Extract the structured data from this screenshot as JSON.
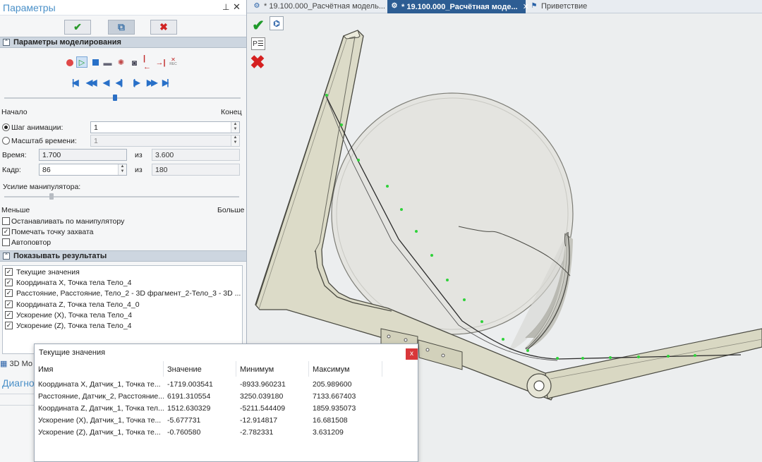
{
  "panel": {
    "title": "Параметры",
    "pin_icon": "pin-icon",
    "close_icon": "close-icon",
    "buttons": {
      "ok": "✔",
      "preview": "⧉",
      "cancel": "✖"
    }
  },
  "modeling": {
    "header": "Параметры моделирования",
    "toolbar_icons": [
      "record-icon",
      "play-icon",
      "stop-icon",
      "film-icon",
      "settings-icon",
      "camera-icon",
      "trim-start-icon",
      "trim-end-icon",
      "rec-icon"
    ],
    "timeline": {
      "start_label": "Начало",
      "end_label": "Конец",
      "position": 0.47
    },
    "anim_step": {
      "label": "Шаг анимации:",
      "value": "1",
      "selected": true
    },
    "time_scale": {
      "label": "Масштаб времени:",
      "value": "1",
      "selected": false
    },
    "time": {
      "label": "Время:",
      "value": "1.700",
      "of_label": "из",
      "total": "3.600"
    },
    "frame": {
      "label": "Кадр:",
      "value": "86",
      "of_label": "из",
      "total": "180"
    },
    "force": {
      "label": "Усилие манипулятора:",
      "min_label": "Меньше",
      "max_label": "Больше",
      "position": 0.2
    },
    "stop_on_manip": {
      "label": "Останавливать по манипулятору",
      "checked": false
    },
    "mark_grip_point": {
      "label": "Помечать точку захвата",
      "checked": true
    },
    "autorepeat": {
      "label": "Автоповтор",
      "checked": false
    }
  },
  "results": {
    "header": "Показывать результаты",
    "items": [
      {
        "label": "Текущие значения",
        "checked": true
      },
      {
        "label": "Координата X, Точка тела Тело_4",
        "checked": true
      },
      {
        "label": "Расстояние, Расстояние, Тело_2 - 3D фрагмент_2-Тело_3 - 3D ...",
        "checked": true
      },
      {
        "label": "Координата Z, Точка тела Тело_4_0",
        "checked": true
      },
      {
        "label": "Ускорение (X), Точка тела Тело_4",
        "checked": true
      },
      {
        "label": "Ускорение (Z), Точка тела Тело_4",
        "checked": true
      }
    ]
  },
  "bottom": {
    "model_tab": "3D Мо",
    "diag_label": "Диагно"
  },
  "tabs": [
    {
      "label": "* 19.100.000_Расчётная модель...",
      "active": false,
      "icon": "document-icon"
    },
    {
      "label": "* 19.100.000_Расчётная моде...",
      "active": true,
      "icon": "document-icon",
      "close": "✕"
    },
    {
      "label": "Приветствие",
      "active": false,
      "icon": "flag-icon"
    }
  ],
  "viewport": {
    "ok_label": "✔",
    "structure_label": "⌬",
    "params_label": "P☰",
    "cancel_label": "✖"
  },
  "result_window": {
    "title": "Текущие значения",
    "close": "x",
    "columns": [
      "Имя",
      "Значение",
      "Минимум",
      "Максимум"
    ],
    "rows": [
      [
        "Координата X, Датчик_1, Точка те...",
        "-1719.003541",
        "-8933.960231",
        "205.989600"
      ],
      [
        "Расстояние, Датчик_2, Расстояние...",
        "6191.310554",
        "3250.039180",
        "7133.667403"
      ],
      [
        "Координата Z, Датчик_1, Точка тел...",
        "1512.630329",
        "-5211.544409",
        "1859.935073"
      ],
      [
        "Ускорение (X), Датчик_1, Точка те...",
        "-5.677731",
        "-12.914817",
        "16.681508"
      ],
      [
        "Ускорение (Z), Датчик_1, Точка те...",
        "-0.760580",
        "-2.782331",
        "3.631209"
      ]
    ]
  },
  "colors": {
    "accent": "#4a90c8",
    "frame_fill": "#dcdbc8",
    "frame_stroke": "#4a4a42",
    "grip_point": "#2fd23a",
    "cancel_red": "#d02323",
    "ok_green": "#2c9a2c"
  }
}
